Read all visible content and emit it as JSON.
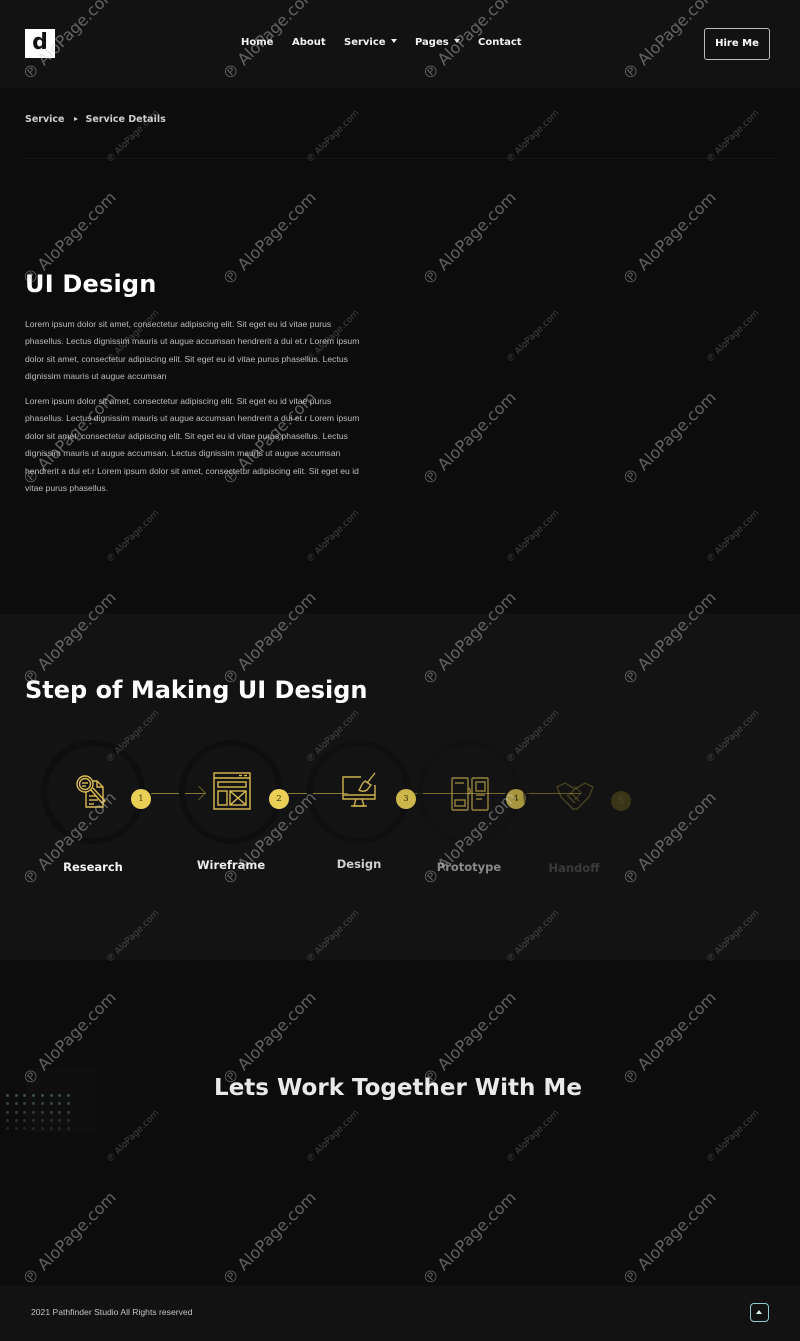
{
  "header": {
    "logo_letter": "d",
    "nav": [
      {
        "label": "Home",
        "dropdown": false
      },
      {
        "label": "About",
        "dropdown": false
      },
      {
        "label": "Service",
        "dropdown": true
      },
      {
        "label": "Pages",
        "dropdown": true
      },
      {
        "label": "Contact",
        "dropdown": false
      }
    ],
    "cta_label": "Hire Me"
  },
  "breadcrumb": {
    "items": [
      "Service",
      "Service Details"
    ]
  },
  "service": {
    "title": "UI Design",
    "paragraphs": [
      "Lorem ipsum dolor sit amet, consectetur adipiscing elit. Sit eget eu id vitae purus phasellus. Lectus dignissim mauris ut augue accumsan hendrerit a dui et.r Lorem ipsum dolor sit amet, consectetur adipiscing elit. Sit eget eu id vitae purus phasellus. Lectus dignissim mauris ut augue accumsan",
      "Lorem ipsum dolor sit amet, consectetur adipiscing elit. Sit eget eu id vitae purus phasellus. Lectus dignissim mauris ut augue accumsan hendrerit a dui et.r Lorem ipsum dolor sit amet, consectetur adipiscing elit. Sit eget eu id vitae purus phasellus. Lectus dignissim mauris ut augue accumsan. Lectus dignissim mauris ut augue accumsan hendrerit a dui et.r Lorem ipsum dolor sit amet, consectetur adipiscing elit. Sit eget eu id vitae purus phasellus."
    ]
  },
  "steps": {
    "title": "Step of Making UI Design",
    "accent_color": "#e9cf55",
    "items": [
      {
        "number": "1",
        "label": "Research",
        "icon": "research-document-magnifier-icon"
      },
      {
        "number": "2",
        "label": "Wireframe",
        "icon": "wireframe-layout-icon"
      },
      {
        "number": "3",
        "label": "Design",
        "icon": "monitor-paintbrush-icon"
      },
      {
        "number": "4",
        "label": "Prototype",
        "icon": "prototype-screens-icon"
      },
      {
        "number": "5",
        "label": "Handoff",
        "icon": "handshake-icon"
      }
    ]
  },
  "cta": {
    "title": "Lets Work Together With Me"
  },
  "footer": {
    "copyright": "2021 Pathfinder Studio All Rights reserved",
    "back_to_top_icon": "arrow-up-icon",
    "back_to_top_color": "#8fcbd6"
  },
  "watermark": {
    "text": "AloPage.com"
  }
}
